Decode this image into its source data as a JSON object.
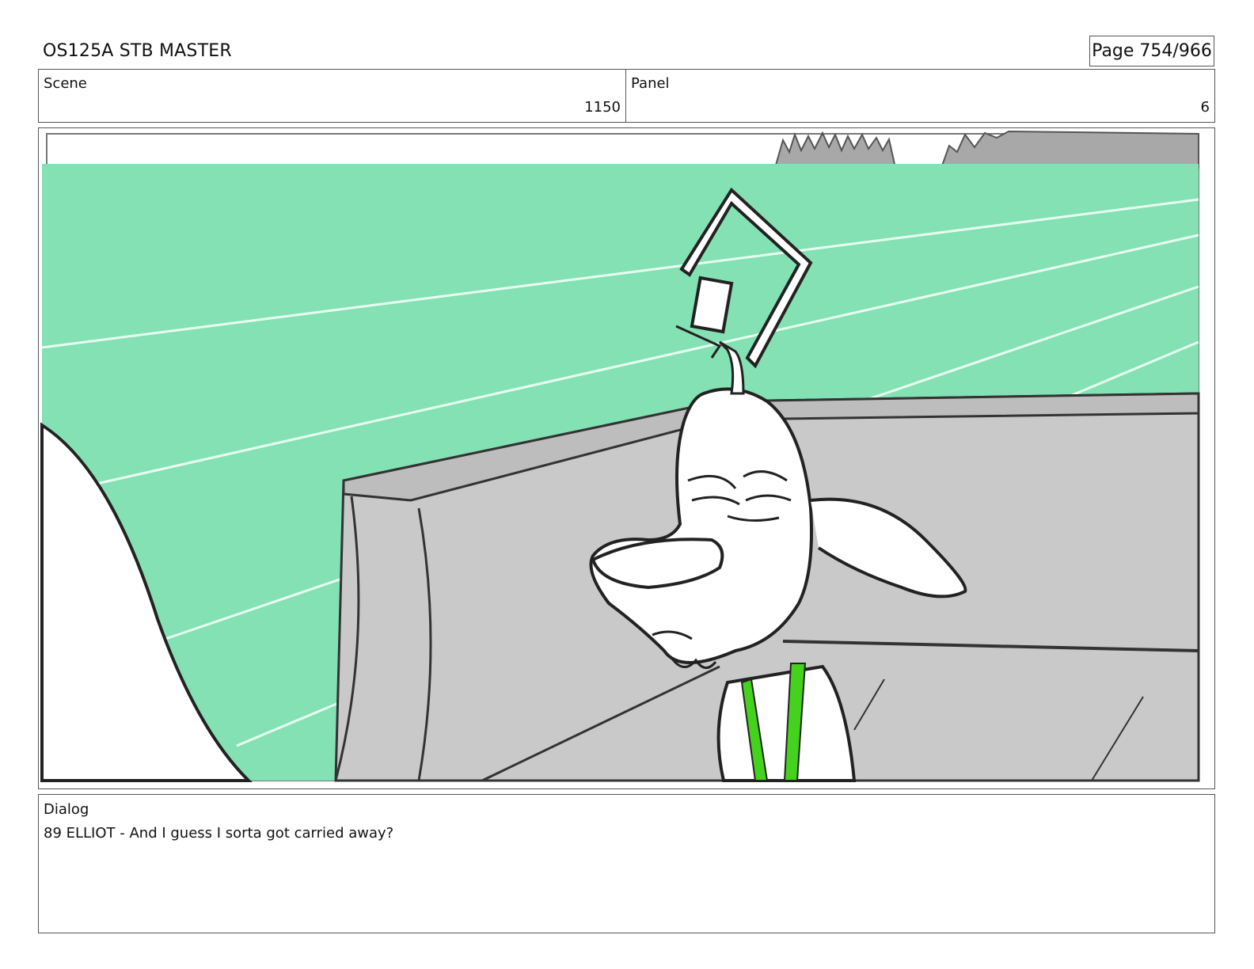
{
  "header": {
    "title": "OS125A STB MASTER",
    "page": "Page 754/966"
  },
  "scene": {
    "label": "Scene",
    "value": "1150"
  },
  "panel": {
    "label": "Panel",
    "value": "6"
  },
  "dialog": {
    "label": "Dialog",
    "text": "89 ELLIOT - And I guess I sorta got carried away?"
  },
  "colors": {
    "sky_green": "#84e1b4",
    "wall_gray": "#c9c9c9",
    "bush_gray": "#a8a8a8",
    "suspender_green": "#44d21e"
  }
}
